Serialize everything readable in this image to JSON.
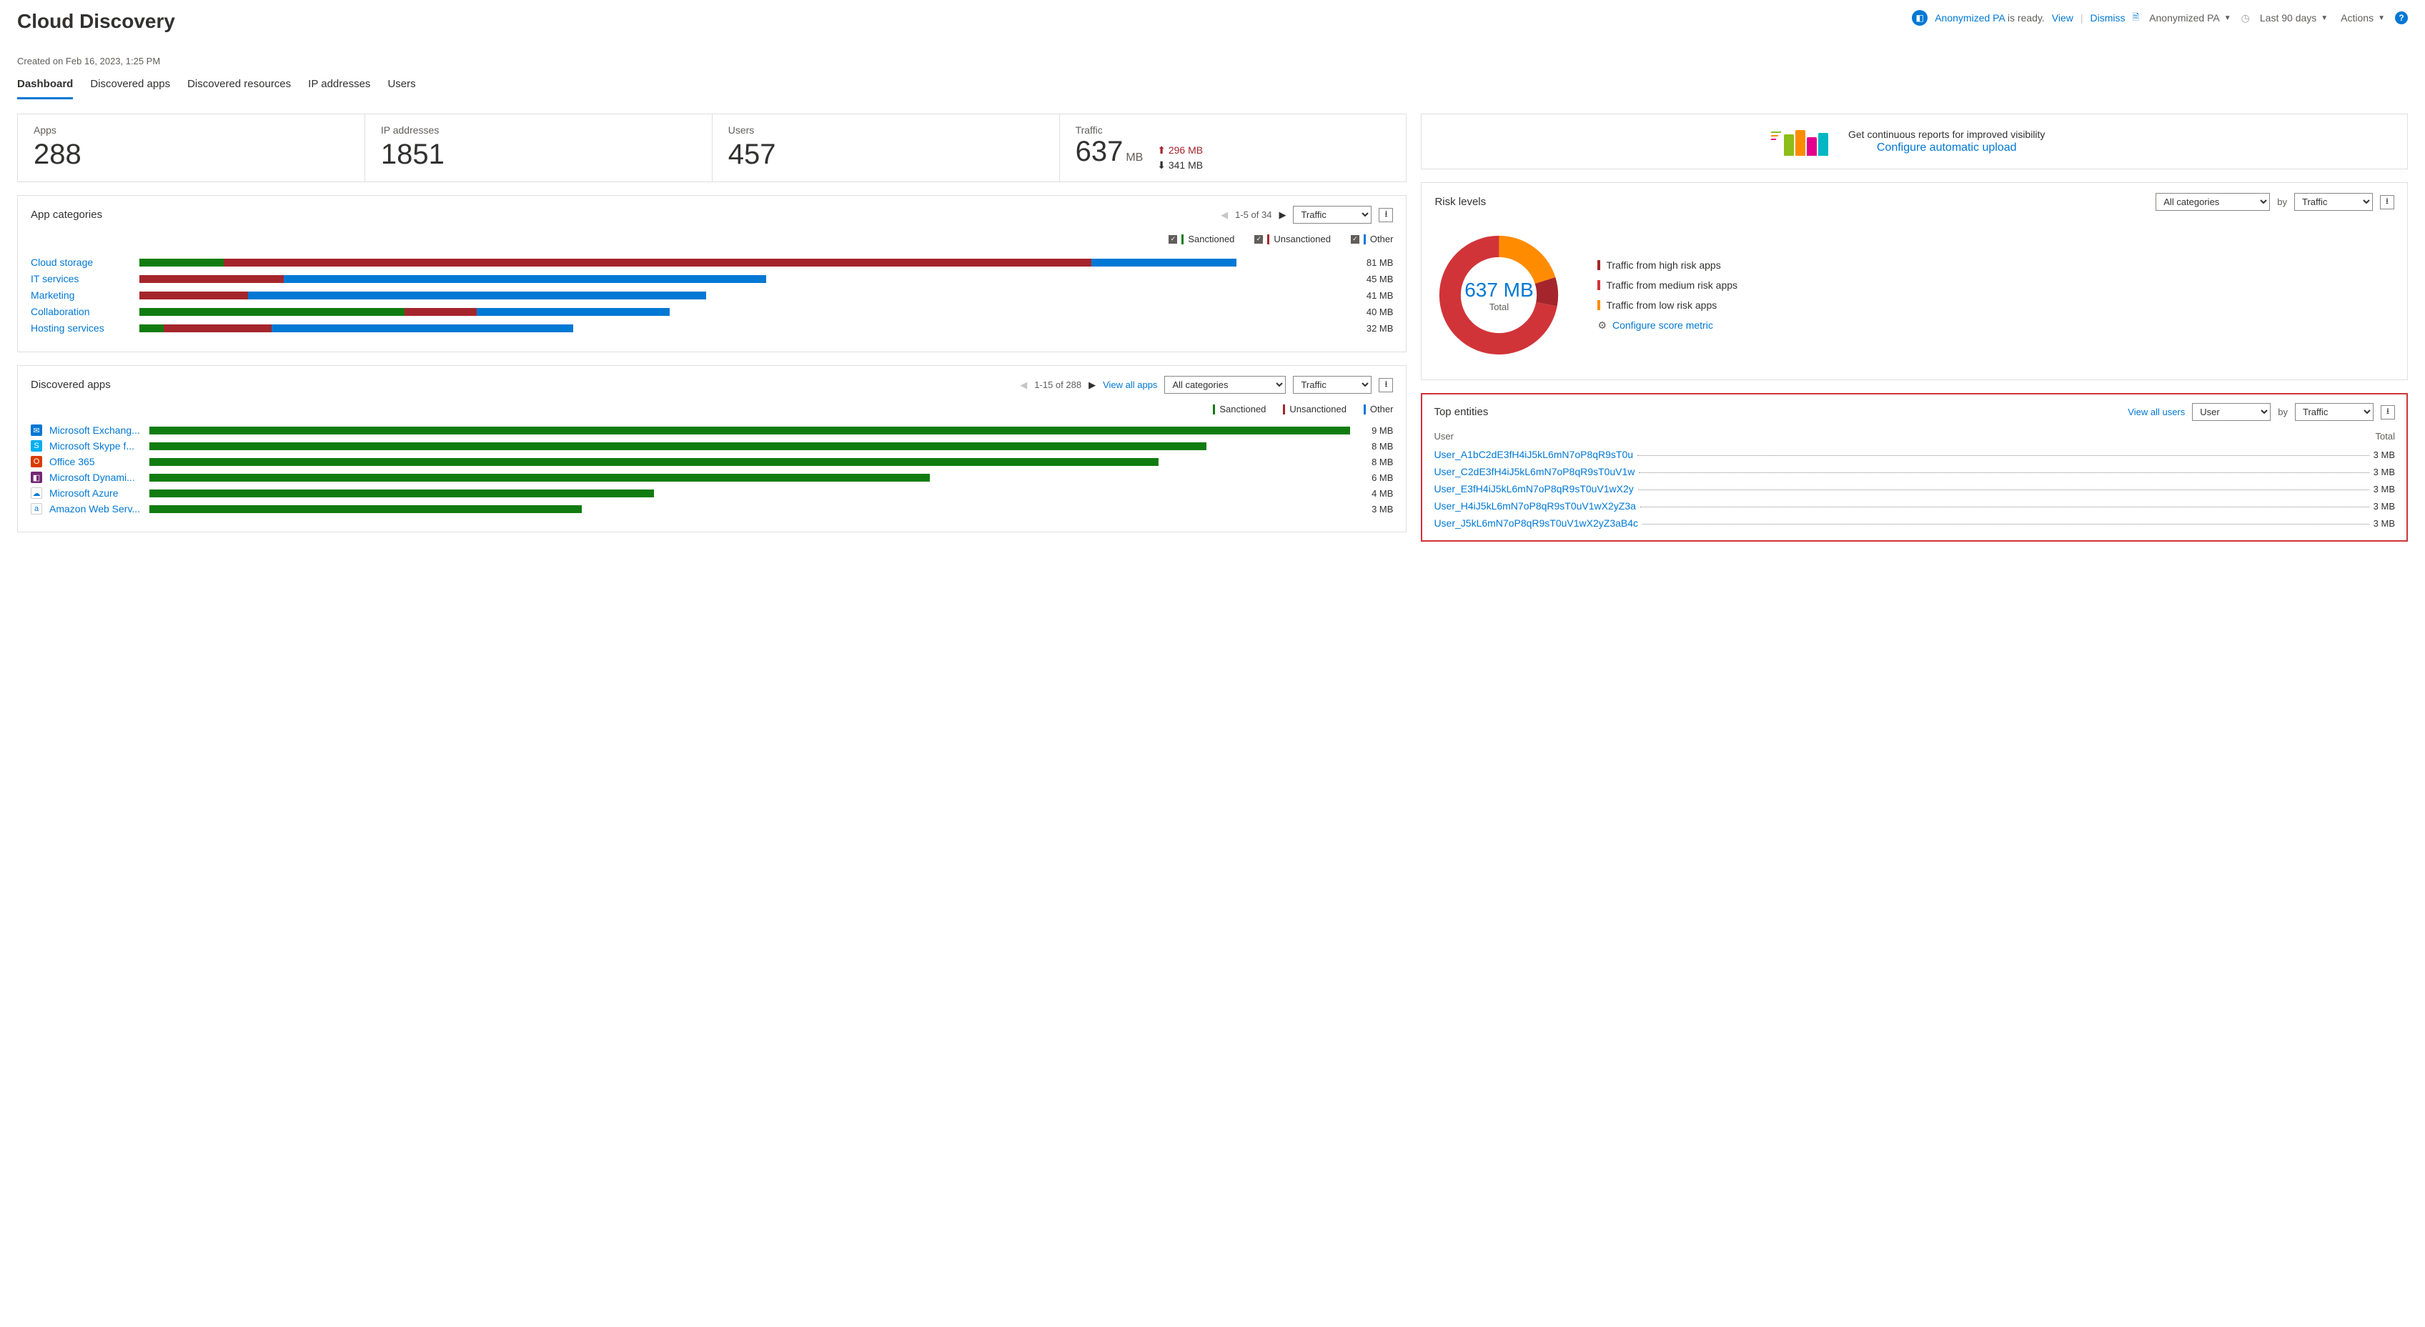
{
  "header": {
    "title": "Cloud Discovery",
    "status": {
      "name": "Anonymized PA",
      "suffix": " is ready.",
      "view": "View",
      "dismiss": "Dismiss"
    },
    "report_selector": "Anonymized PA",
    "time_selector": "Last 90 days",
    "actions": "Actions",
    "created_on": "Created on Feb 16, 2023, 1:25 PM"
  },
  "tabs": [
    "Dashboard",
    "Discovered apps",
    "Discovered resources",
    "IP addresses",
    "Users"
  ],
  "active_tab": "Dashboard",
  "kpis": {
    "apps": {
      "label": "Apps",
      "value": "288"
    },
    "ips": {
      "label": "IP addresses",
      "value": "1851"
    },
    "users": {
      "label": "Users",
      "value": "457"
    },
    "traffic": {
      "label": "Traffic",
      "value": "637",
      "unit": "MB",
      "up": "296 MB",
      "down": "341 MB"
    }
  },
  "promo": {
    "line1": "Get continuous reports for improved visibility",
    "line2": "Configure automatic upload"
  },
  "app_categories": {
    "title": "App categories",
    "pager": "1-5 of 34",
    "sort_options": [
      "Traffic"
    ],
    "legend": {
      "sanctioned": "Sanctioned",
      "unsanctioned": "Unsanctioned",
      "other": "Other"
    },
    "rows": [
      {
        "name": "Cloud storage",
        "value": "81 MB",
        "sanctioned": 7,
        "unsanctioned": 72,
        "other": 12
      },
      {
        "name": "IT services",
        "value": "45 MB",
        "sanctioned": 0,
        "unsanctioned": 12,
        "other": 40
      },
      {
        "name": "Marketing",
        "value": "41 MB",
        "sanctioned": 0,
        "unsanctioned": 9,
        "other": 38
      },
      {
        "name": "Collaboration",
        "value": "40 MB",
        "sanctioned": 22,
        "unsanctioned": 6,
        "other": 16
      },
      {
        "name": "Hosting services",
        "value": "32 MB",
        "sanctioned": 2,
        "unsanctioned": 9,
        "other": 25
      }
    ]
  },
  "risk_levels": {
    "title": "Risk levels",
    "cat_options": [
      "All categories"
    ],
    "by_label": "by",
    "sort_options": [
      "Traffic"
    ],
    "center_value": "637 MB",
    "center_label": "Total",
    "legend": {
      "high": "Traffic from high risk apps",
      "med": "Traffic from medium risk apps",
      "low": "Traffic from low risk apps",
      "config": "Configure score metric"
    }
  },
  "discovered_apps": {
    "title": "Discovered apps",
    "pager": "1-15 of 288",
    "view_all": "View all apps",
    "cat_options": [
      "All categories"
    ],
    "sort_options": [
      "Traffic"
    ],
    "legend": {
      "sanctioned": "Sanctioned",
      "unsanctioned": "Unsanctioned",
      "other": "Other"
    },
    "rows": [
      {
        "name": "Microsoft Exchang...",
        "value": "9 MB",
        "bar": 100,
        "color": "sanctioned",
        "icon_bg": "#0078d4",
        "icon_char": "✉"
      },
      {
        "name": "Microsoft Skype f...",
        "value": "8 MB",
        "bar": 88,
        "color": "sanctioned",
        "icon_bg": "#00aff0",
        "icon_char": "S"
      },
      {
        "name": "Office 365",
        "value": "8 MB",
        "bar": 84,
        "color": "sanctioned",
        "icon_bg": "#d83b01",
        "icon_char": "O"
      },
      {
        "name": "Microsoft Dynami...",
        "value": "6 MB",
        "bar": 65,
        "color": "sanctioned",
        "icon_bg": "#742774",
        "icon_char": "◧"
      },
      {
        "name": "Microsoft Azure",
        "value": "4 MB",
        "bar": 42,
        "color": "sanctioned",
        "icon_bg": "#ffffff",
        "icon_char": "☁"
      },
      {
        "name": "Amazon Web Serv...",
        "value": "3 MB",
        "bar": 36,
        "color": "sanctioned",
        "icon_bg": "#ffffff",
        "icon_char": "a"
      }
    ]
  },
  "top_entities": {
    "title": "Top entities",
    "view_all": "View all users",
    "type_options": [
      "User"
    ],
    "by_label": "by",
    "sort_options": [
      "Traffic"
    ],
    "col_user": "User",
    "col_total": "Total",
    "rows": [
      {
        "name": "User_A1bC2dE3fH4iJ5kL6mN7oP8qR9sT0u",
        "total": "3 MB"
      },
      {
        "name": "User_C2dE3fH4iJ5kL6mN7oP8qR9sT0uV1w",
        "total": "3 MB"
      },
      {
        "name": "User_E3fH4iJ5kL6mN7oP8qR9sT0uV1wX2y",
        "total": "3 MB"
      },
      {
        "name": "User_H4iJ5kL6mN7oP8qR9sT0uV1wX2yZ3a",
        "total": "3 MB"
      },
      {
        "name": "User_J5kL6mN7oP8qR9sT0uV1wX2yZ3aB4c",
        "total": "3 MB"
      }
    ]
  },
  "chart_data": {
    "app_categories_bars": {
      "type": "bar",
      "orientation": "horizontal-stacked",
      "categories": [
        "Cloud storage",
        "IT services",
        "Marketing",
        "Collaboration",
        "Hosting services"
      ],
      "series": [
        {
          "name": "Sanctioned",
          "values": [
            7,
            0,
            0,
            22,
            2
          ]
        },
        {
          "name": "Unsanctioned",
          "values": [
            72,
            12,
            9,
            6,
            9
          ]
        },
        {
          "name": "Other",
          "values": [
            12,
            40,
            38,
            16,
            25
          ]
        }
      ],
      "totals_label": [
        "81 MB",
        "45 MB",
        "41 MB",
        "40 MB",
        "32 MB"
      ],
      "xlabel": "",
      "ylabel": "",
      "unit": "MB (approx % of max)"
    },
    "risk_donut": {
      "type": "pie",
      "title": "Risk levels",
      "center": "637 MB Total",
      "slices": [
        {
          "name": "high",
          "pct": 8,
          "color": "#a4262c"
        },
        {
          "name": "medium",
          "pct": 72,
          "color": "#d13438"
        },
        {
          "name": "low",
          "pct": 20,
          "color": "#ff8c00"
        }
      ]
    },
    "discovered_apps_bars": {
      "type": "bar",
      "orientation": "horizontal",
      "categories": [
        "Microsoft Exchange",
        "Microsoft Skype for Business",
        "Office 365",
        "Microsoft Dynamics",
        "Microsoft Azure",
        "Amazon Web Services"
      ],
      "values_label": [
        "9 MB",
        "8 MB",
        "8 MB",
        "6 MB",
        "4 MB",
        "3 MB"
      ],
      "values_rel": [
        100,
        88,
        84,
        65,
        42,
        36
      ],
      "series_color": "Sanctioned"
    }
  }
}
